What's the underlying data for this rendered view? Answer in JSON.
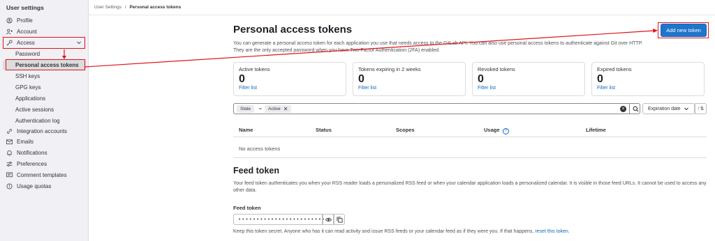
{
  "sidebar": {
    "title": "User settings",
    "items": [
      {
        "label": "Profile",
        "icon": "profile-icon"
      },
      {
        "label": "Account",
        "icon": "account-icon"
      },
      {
        "label": "Access",
        "icon": "key-icon"
      }
    ],
    "access_subitems": [
      "Password",
      "Personal access tokens",
      "SSH keys",
      "GPG keys",
      "Applications",
      "Active sessions",
      "Authentication log"
    ],
    "items_after": [
      {
        "label": "Integration accounts",
        "icon": "link-icon"
      },
      {
        "label": "Emails",
        "icon": "mail-icon"
      },
      {
        "label": "Notifications",
        "icon": "bell-icon"
      },
      {
        "label": "Preferences",
        "icon": "preferences-icon"
      },
      {
        "label": "Comment templates",
        "icon": "comment-icon"
      },
      {
        "label": "Usage quotas",
        "icon": "quota-icon"
      }
    ]
  },
  "breadcrumb": {
    "parent": "User Settings",
    "sep": "/",
    "current": "Personal access tokens"
  },
  "page": {
    "title": "Personal access tokens",
    "intro_1": "You can generate a personal access token for each application you use that needs access to the GitLab API. You can also use personal access tokens to authenticate against Git over HTTP.",
    "intro_2": "They are the only accepted password when you have Two-Factor Authentication (2FA) enabled.",
    "add_button": "Add new token"
  },
  "stats": [
    {
      "label": "Active tokens",
      "value": "0",
      "link": "Filter list"
    },
    {
      "label": "Tokens expiring in 2 weeks",
      "value": "0",
      "link": "Filter list"
    },
    {
      "label": "Revoked tokens",
      "value": "0",
      "link": "Filter list"
    },
    {
      "label": "Expired tokens",
      "value": "0",
      "link": "Filter list"
    }
  ],
  "filter": {
    "key": "State",
    "op": "=",
    "value": "Active",
    "sort_label": "Expiration date"
  },
  "table": {
    "headers": [
      "Name",
      "Status",
      "Scopes",
      "Usage",
      "Lifetime"
    ],
    "empty": "No access tokens"
  },
  "feed": {
    "title": "Feed token",
    "desc": "Your feed token authenticates you when your RSS reader loads a personalized RSS feed or when your calendar application loads a personalized calendar. It is visible in those feed URLs. It cannot be used to access any other data.",
    "label": "Feed token",
    "masked": "••••••••••••••••••••••••",
    "keep_text": "Keep this token secret. Anyone who has it can read activity and issue RSS feeds or your calendar feed as if they were you. If that happens,",
    "reset_link": "reset this token",
    "keep_end": "."
  },
  "colors": {
    "primary": "#1f75cb",
    "link": "#1068bf",
    "highlight": "#e0131a"
  }
}
